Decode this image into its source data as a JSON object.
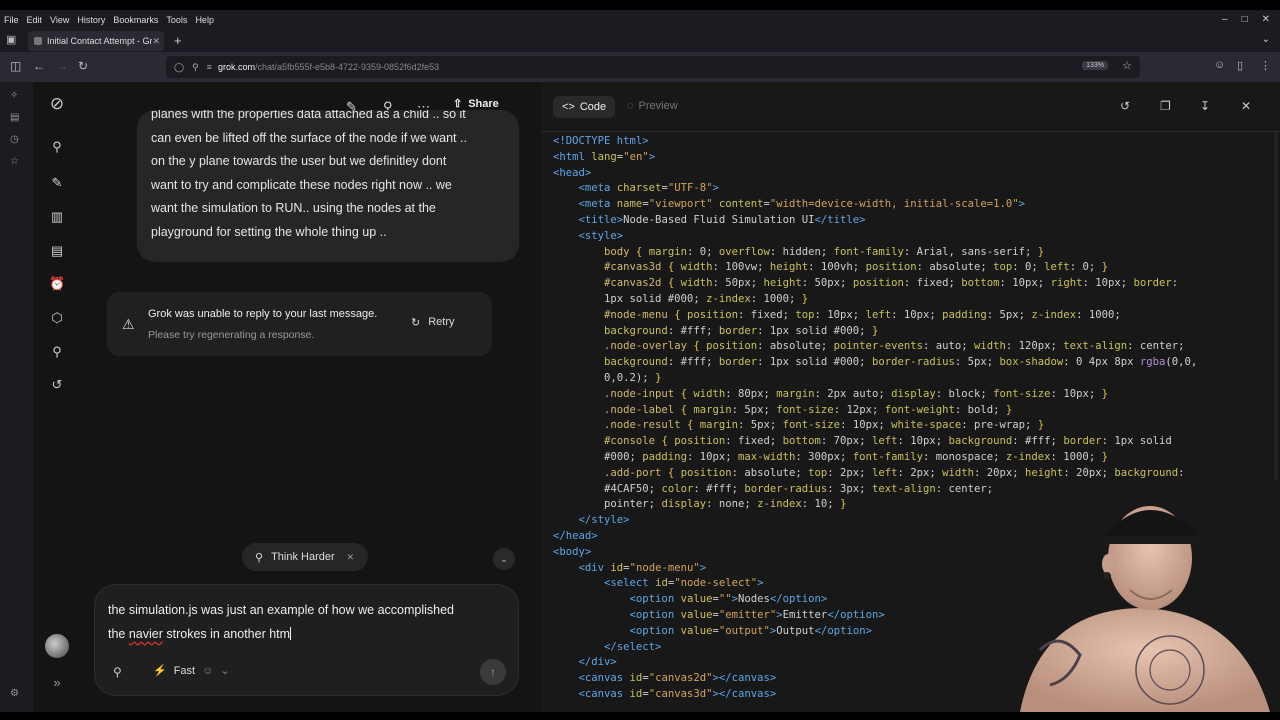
{
  "menu": [
    "File",
    "Edit",
    "View",
    "History",
    "Bookmarks",
    "Tools",
    "Help"
  ],
  "tab": {
    "title": "Initial Contact Attempt - Gr"
  },
  "url": {
    "host": "grok.com",
    "path": "/chat/a5fb555f-e5b8-4722-9359-0852f6d2fe53",
    "zoom": "133%"
  },
  "chat": {
    "share_label": "Share",
    "user_message_lines": [
      "planes with the properties data attached as a child .. so it",
      "can even be lifted off the surface of the node if we want ..",
      "on the y plane towards the user but we definitley dont",
      "want to try and complicate these nodes right now .. we",
      "want the simulation to RUN.. using the nodes at the",
      "playground for setting the whole thing up .."
    ],
    "error": {
      "title": "Grok was unable to reply to your last message.",
      "subtitle": "Please try regenerating a response.",
      "retry_label": "Retry"
    },
    "think_chip": "Think Harder",
    "composer": {
      "line1": "the simulation.js was just an example of how we accomplished",
      "line2_pre": "the ",
      "line2_misspelled": "navier",
      "line2_post": " strokes in another htm",
      "mode": "Fast"
    }
  },
  "code_panel": {
    "code_tab": "Code",
    "preview_tab": "Preview",
    "lines": [
      [
        [
          "t",
          "<!DOCTYPE html>"
        ]
      ],
      [
        [
          "t",
          "<html "
        ],
        [
          "a",
          "lang"
        ],
        [
          "p",
          "="
        ],
        [
          "s",
          "\"en\""
        ],
        [
          "t",
          ">"
        ]
      ],
      [
        [
          "t",
          "<head>"
        ]
      ],
      [
        [
          "p",
          "    "
        ],
        [
          "t",
          "<meta "
        ],
        [
          "a",
          "charset"
        ],
        [
          "p",
          "="
        ],
        [
          "s",
          "\"UTF-8\""
        ],
        [
          "t",
          ">"
        ]
      ],
      [
        [
          "p",
          "    "
        ],
        [
          "t",
          "<meta "
        ],
        [
          "a",
          "name"
        ],
        [
          "p",
          "="
        ],
        [
          "s",
          "\"viewport\""
        ],
        [
          "p",
          " "
        ],
        [
          "a",
          "content"
        ],
        [
          "p",
          "="
        ],
        [
          "s",
          "\"width=device-width, initial-scale=1.0\""
        ],
        [
          "t",
          ">"
        ]
      ],
      [
        [
          "p",
          "    "
        ],
        [
          "t",
          "<title>"
        ],
        [
          "p",
          "Node-Based Fluid Simulation UI"
        ],
        [
          "t",
          "</title>"
        ]
      ],
      [
        [
          "p",
          "    "
        ],
        [
          "t",
          "<style>"
        ]
      ],
      [
        [
          "p",
          "        "
        ],
        [
          "sel",
          "body"
        ],
        [
          "b",
          " { "
        ],
        [
          "prop",
          "margin"
        ],
        [
          "p",
          ": 0; "
        ],
        [
          "prop",
          "overflow"
        ],
        [
          "p",
          ": hidden; "
        ],
        [
          "prop",
          "font-family"
        ],
        [
          "p",
          ": Arial, sans-serif; "
        ],
        [
          "b",
          "}"
        ]
      ],
      [
        [
          "p",
          "        "
        ],
        [
          "sel",
          "#canvas3d"
        ],
        [
          "b",
          " { "
        ],
        [
          "prop",
          "width"
        ],
        [
          "p",
          ": 100vw; "
        ],
        [
          "prop",
          "height"
        ],
        [
          "p",
          ": 100vh; "
        ],
        [
          "prop",
          "position"
        ],
        [
          "p",
          ": absolute; "
        ],
        [
          "prop",
          "top"
        ],
        [
          "p",
          ": 0; "
        ],
        [
          "prop",
          "left"
        ],
        [
          "p",
          ": 0; "
        ],
        [
          "b",
          "}"
        ]
      ],
      [
        [
          "p",
          "        "
        ],
        [
          "sel",
          "#canvas2d"
        ],
        [
          "b",
          " { "
        ],
        [
          "prop",
          "width"
        ],
        [
          "p",
          ": 50px; "
        ],
        [
          "prop",
          "height"
        ],
        [
          "p",
          ": 50px; "
        ],
        [
          "prop",
          "position"
        ],
        [
          "p",
          ": fixed; "
        ],
        [
          "prop",
          "bottom"
        ],
        [
          "p",
          ": 10px; "
        ],
        [
          "prop",
          "right"
        ],
        [
          "p",
          ": 10px; "
        ],
        [
          "prop",
          "border"
        ],
        [
          "p",
          ":"
        ]
      ],
      [
        [
          "p",
          "        1px solid #000; "
        ],
        [
          "prop",
          "z-index"
        ],
        [
          "p",
          ": 1000; "
        ],
        [
          "b",
          "}"
        ]
      ],
      [
        [
          "p",
          "        "
        ],
        [
          "sel",
          "#node-menu"
        ],
        [
          "b",
          " { "
        ],
        [
          "prop",
          "position"
        ],
        [
          "p",
          ": fixed; "
        ],
        [
          "prop",
          "top"
        ],
        [
          "p",
          ": 10px; "
        ],
        [
          "prop",
          "left"
        ],
        [
          "p",
          ": 10px; "
        ],
        [
          "prop",
          "padding"
        ],
        [
          "p",
          ": 5px; "
        ],
        [
          "prop",
          "z-index"
        ],
        [
          "p",
          ": 1000;"
        ]
      ],
      [
        [
          "p",
          "        "
        ],
        [
          "prop",
          "background"
        ],
        [
          "p",
          ": #fff; "
        ],
        [
          "prop",
          "border"
        ],
        [
          "p",
          ": 1px solid #000; "
        ],
        [
          "b",
          "}"
        ]
      ],
      [
        [
          "p",
          "        "
        ],
        [
          "sel",
          ".node-overlay"
        ],
        [
          "b",
          " { "
        ],
        [
          "prop",
          "position"
        ],
        [
          "p",
          ": absolute; "
        ],
        [
          "prop",
          "pointer-events"
        ],
        [
          "p",
          ": auto; "
        ],
        [
          "prop",
          "width"
        ],
        [
          "p",
          ": 120px; "
        ],
        [
          "prop",
          "text-align"
        ],
        [
          "p",
          ": center;"
        ]
      ],
      [
        [
          "p",
          "        "
        ],
        [
          "prop",
          "background"
        ],
        [
          "p",
          ": #fff; "
        ],
        [
          "prop",
          "border"
        ],
        [
          "p",
          ": 1px solid #000; "
        ],
        [
          "prop",
          "border-radius"
        ],
        [
          "p",
          ": 5px; "
        ],
        [
          "prop",
          "box-shadow"
        ],
        [
          "p",
          ": 0 4px 8px "
        ],
        [
          "fn",
          "rgba"
        ],
        [
          "p",
          "(0,0,"
        ]
      ],
      [
        [
          "p",
          "        0,0.2); "
        ],
        [
          "b",
          "}"
        ]
      ],
      [
        [
          "p",
          "        "
        ],
        [
          "sel",
          ".node-input"
        ],
        [
          "b",
          " { "
        ],
        [
          "prop",
          "width"
        ],
        [
          "p",
          ": 80px; "
        ],
        [
          "prop",
          "margin"
        ],
        [
          "p",
          ": 2px auto; "
        ],
        [
          "prop",
          "display"
        ],
        [
          "p",
          ": block; "
        ],
        [
          "prop",
          "font-size"
        ],
        [
          "p",
          ": 10px; "
        ],
        [
          "b",
          "}"
        ]
      ],
      [
        [
          "p",
          "        "
        ],
        [
          "sel",
          ".node-label"
        ],
        [
          "b",
          " { "
        ],
        [
          "prop",
          "margin"
        ],
        [
          "p",
          ": 5px; "
        ],
        [
          "prop",
          "font-size"
        ],
        [
          "p",
          ": 12px; "
        ],
        [
          "prop",
          "font-weight"
        ],
        [
          "p",
          ": bold; "
        ],
        [
          "b",
          "}"
        ]
      ],
      [
        [
          "p",
          "        "
        ],
        [
          "sel",
          ".node-result"
        ],
        [
          "b",
          " { "
        ],
        [
          "prop",
          "margin"
        ],
        [
          "p",
          ": 5px; "
        ],
        [
          "prop",
          "font-size"
        ],
        [
          "p",
          ": 10px; "
        ],
        [
          "prop",
          "white-space"
        ],
        [
          "p",
          ": pre-wrap; "
        ],
        [
          "b",
          "}"
        ]
      ],
      [
        [
          "p",
          "        "
        ],
        [
          "sel",
          "#console"
        ],
        [
          "b",
          " { "
        ],
        [
          "prop",
          "position"
        ],
        [
          "p",
          ": fixed; "
        ],
        [
          "prop",
          "bottom"
        ],
        [
          "p",
          ": 70px; "
        ],
        [
          "prop",
          "left"
        ],
        [
          "p",
          ": 10px; "
        ],
        [
          "prop",
          "background"
        ],
        [
          "p",
          ": #fff; "
        ],
        [
          "prop",
          "border"
        ],
        [
          "p",
          ": 1px solid"
        ]
      ],
      [
        [
          "p",
          "        #000; "
        ],
        [
          "prop",
          "padding"
        ],
        [
          "p",
          ": 10px; "
        ],
        [
          "prop",
          "max-width"
        ],
        [
          "p",
          ": 300px; "
        ],
        [
          "prop",
          "font-family"
        ],
        [
          "p",
          ": monospace; "
        ],
        [
          "prop",
          "z-index"
        ],
        [
          "p",
          ": 1000; "
        ],
        [
          "b",
          "}"
        ]
      ],
      [
        [
          "p",
          "        "
        ],
        [
          "sel",
          ".add-port"
        ],
        [
          "b",
          " { "
        ],
        [
          "prop",
          "position"
        ],
        [
          "p",
          ": absolute; "
        ],
        [
          "prop",
          "top"
        ],
        [
          "p",
          ": 2px; "
        ],
        [
          "prop",
          "left"
        ],
        [
          "p",
          ": 2px; "
        ],
        [
          "prop",
          "width"
        ],
        [
          "p",
          ": 20px; "
        ],
        [
          "prop",
          "height"
        ],
        [
          "p",
          ": 20px; "
        ],
        [
          "prop",
          "background"
        ],
        [
          "p",
          ":"
        ]
      ],
      [
        [
          "p",
          "        #4CAF50; "
        ],
        [
          "prop",
          "color"
        ],
        [
          "p",
          ": #fff; "
        ],
        [
          "prop",
          "border-radius"
        ],
        [
          "p",
          ": 3px; "
        ],
        [
          "prop",
          "text-align"
        ],
        [
          "p",
          ": center; "
        ],
        [
          "prop",
          "line-height"
        ],
        [
          "p",
          ": 20px; "
        ],
        [
          "prop",
          "cursor"
        ],
        [
          "p",
          ":"
        ]
      ],
      [
        [
          "p",
          "        pointer; "
        ],
        [
          "prop",
          "display"
        ],
        [
          "p",
          ": none; "
        ],
        [
          "prop",
          "z-index"
        ],
        [
          "p",
          ": 10; "
        ],
        [
          "b",
          "}"
        ]
      ],
      [
        [
          "p",
          "    "
        ],
        [
          "t",
          "</style>"
        ]
      ],
      [
        [
          "t",
          "</head>"
        ]
      ],
      [
        [
          "t",
          "<body>"
        ]
      ],
      [
        [
          "p",
          "    "
        ],
        [
          "t",
          "<div "
        ],
        [
          "a",
          "id"
        ],
        [
          "p",
          "="
        ],
        [
          "s",
          "\"node-menu\""
        ],
        [
          "t",
          ">"
        ]
      ],
      [
        [
          "p",
          "        "
        ],
        [
          "t",
          "<select "
        ],
        [
          "a",
          "id"
        ],
        [
          "p",
          "="
        ],
        [
          "s",
          "\"node-select\""
        ],
        [
          "t",
          ">"
        ]
      ],
      [
        [
          "p",
          "            "
        ],
        [
          "t",
          "<option "
        ],
        [
          "a",
          "value"
        ],
        [
          "p",
          "="
        ],
        [
          "s",
          "\"\""
        ],
        [
          "t",
          ">"
        ],
        [
          "p",
          "Nodes"
        ],
        [
          "t",
          "</option>"
        ]
      ],
      [
        [
          "p",
          "            "
        ],
        [
          "t",
          "<option "
        ],
        [
          "a",
          "value"
        ],
        [
          "p",
          "="
        ],
        [
          "s",
          "\"emitter\""
        ],
        [
          "t",
          ">"
        ],
        [
          "p",
          "Emitter"
        ],
        [
          "t",
          "</option>"
        ]
      ],
      [
        [
          "p",
          "            "
        ],
        [
          "t",
          "<option "
        ],
        [
          "a",
          "value"
        ],
        [
          "p",
          "="
        ],
        [
          "s",
          "\"output\""
        ],
        [
          "t",
          ">"
        ],
        [
          "p",
          "Output"
        ],
        [
          "t",
          "</option>"
        ]
      ],
      [
        [
          "p",
          "        "
        ],
        [
          "t",
          "</select>"
        ]
      ],
      [
        [
          "p",
          "    "
        ],
        [
          "t",
          "</div>"
        ]
      ],
      [
        [
          "p",
          "    "
        ],
        [
          "t",
          "<canvas "
        ],
        [
          "a",
          "id"
        ],
        [
          "p",
          "="
        ],
        [
          "s",
          "\"canvas2d\""
        ],
        [
          "t",
          "></canvas>"
        ]
      ],
      [
        [
          "p",
          "    "
        ],
        [
          "t",
          "<canvas "
        ],
        [
          "a",
          "id"
        ],
        [
          "p",
          "="
        ],
        [
          "s",
          "\"canvas3d\""
        ],
        [
          "t",
          "></canvas>"
        ]
      ]
    ]
  },
  "colors": {
    "tag": "#5ea5e8",
    "attr": "#c9c15a",
    "string": "#d3a35d",
    "selector": "#d4b86a",
    "property": "#c9c15a",
    "brace": "#e0c14e",
    "plain": "#cfcfcf",
    "func": "#b58bd6"
  }
}
